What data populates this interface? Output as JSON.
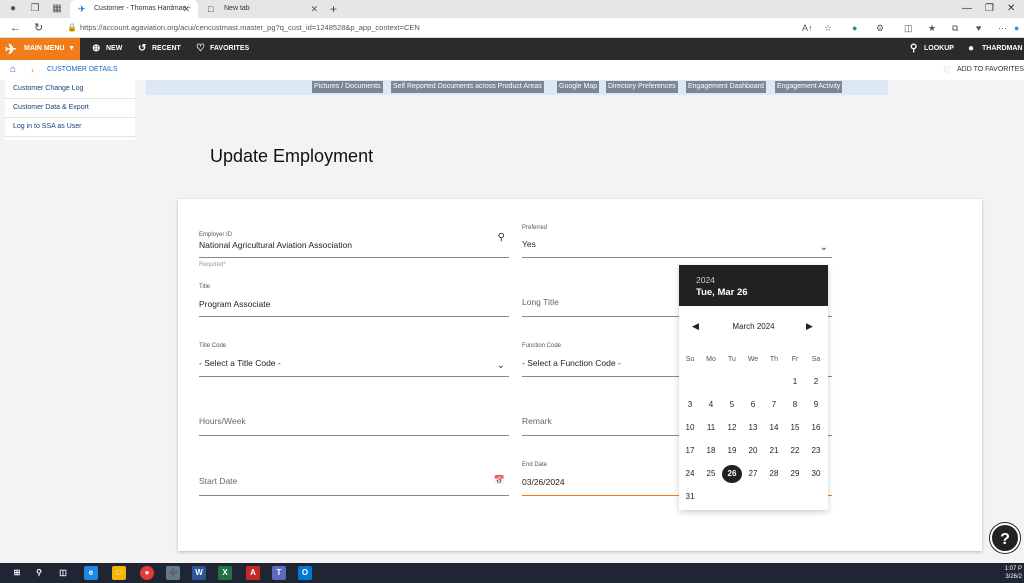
{
  "browser": {
    "tabs": [
      {
        "label": "Customer - Thomas Hardman - "
      },
      {
        "label": "New tab"
      }
    ],
    "url": "https://account.agaviation.org/acui/cencustmast.master_pg?q_cust_id=1248528&p_app_context=CEN"
  },
  "appnav": {
    "main_menu": "MAIN MENU",
    "new": "NEW",
    "recent": "RECENT",
    "favorites": "FAVORITES",
    "lookup": "LOOKUP",
    "user": "THARDMAN"
  },
  "breadcrumb": {
    "current": "CUSTOMER DETAILS",
    "add_to_favorites": "ADD TO FAVORITES"
  },
  "sidebar": {
    "items": [
      {
        "label": "Customer Change Log"
      },
      {
        "label": "Customer Data & Export"
      },
      {
        "label": "Log in to SSA as User"
      }
    ]
  },
  "links": [
    {
      "label": "Pictures / Documents"
    },
    {
      "label": "Self Reported Documents across Product Areas"
    },
    {
      "label": "Google Map"
    },
    {
      "label": "Directory Preferences"
    },
    {
      "label": "Engagement Dashboard"
    },
    {
      "label": "Engagement Activity"
    }
  ],
  "page": {
    "title": "Update Employment"
  },
  "form": {
    "employer_id": {
      "label": "Employer ID",
      "value": "National Agricultural Aviation Association",
      "helper": "Required*"
    },
    "preferred": {
      "label": "Preferred",
      "value": "Yes"
    },
    "title": {
      "label": "Title",
      "value": "Program Associate"
    },
    "long_title": {
      "placeholder": "Long Title"
    },
    "title_code": {
      "label": "Title Code",
      "value": "- Select a Title Code -"
    },
    "function_code": {
      "label": "Function Code",
      "value": "- Select a Function Code -"
    },
    "hours_week": {
      "placeholder": "Hours/Week"
    },
    "remark": {
      "placeholder": "Remark"
    },
    "start_date": {
      "placeholder": "Start Date"
    },
    "end_date": {
      "label": "End Date",
      "value": "03/26/2024"
    }
  },
  "datepicker": {
    "year": "2024",
    "selected_label": "Tue, Mar 26",
    "month_label": "March 2024",
    "weekdays": [
      "Su",
      "Mo",
      "Tu",
      "We",
      "Th",
      "Fr",
      "Sa"
    ],
    "days": [
      "1",
      "2",
      "3",
      "4",
      "5",
      "6",
      "7",
      "8",
      "9",
      "10",
      "11",
      "12",
      "13",
      "14",
      "15",
      "16",
      "17",
      "18",
      "19",
      "20",
      "21",
      "22",
      "23",
      "24",
      "25",
      "26",
      "27",
      "28",
      "29",
      "30",
      "31"
    ],
    "first_weekday": 5,
    "selected_day": 26
  },
  "help": {
    "label": "?"
  },
  "taskbar": {
    "time": "1:07 P",
    "date": "3/26/2"
  }
}
